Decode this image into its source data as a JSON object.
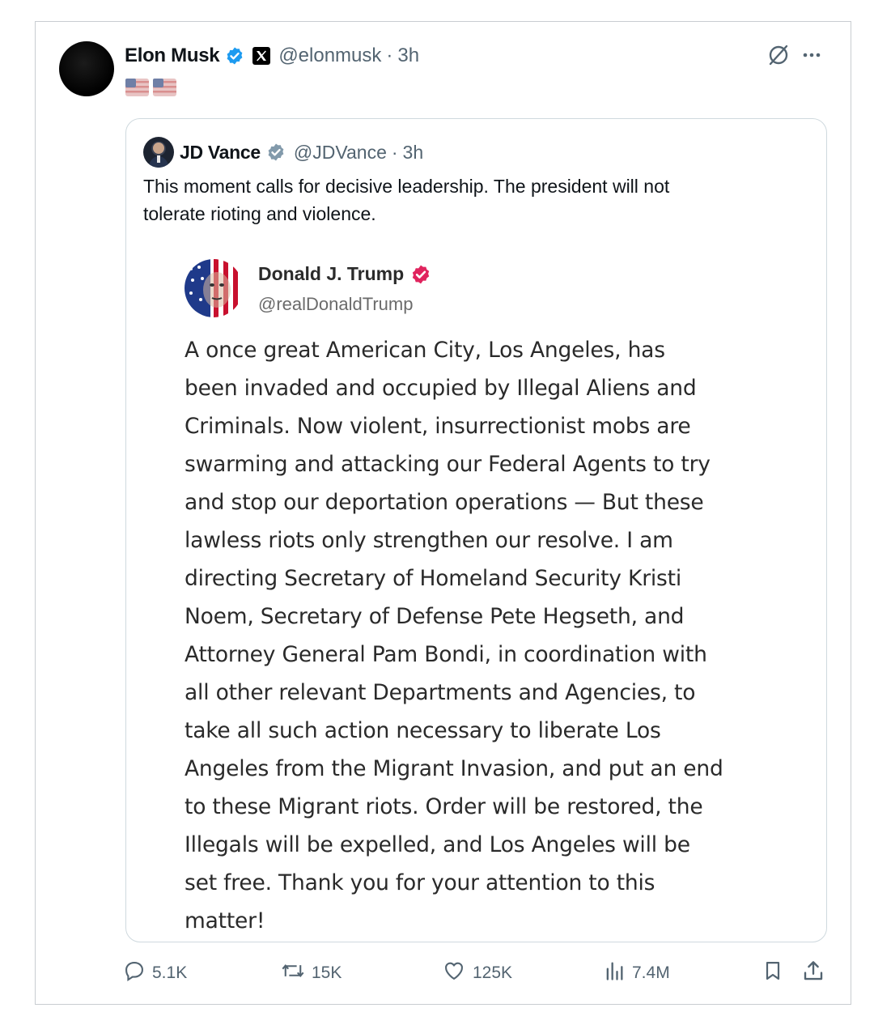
{
  "tweet": {
    "author_name": "Elon Musk",
    "handle": "@elonmusk",
    "time": "3h",
    "separator": "·",
    "flags": [
      "🇺🇸",
      "🇺🇸"
    ]
  },
  "quoted": {
    "author_name": "JD Vance",
    "handle": "@JDVance",
    "time": "3h",
    "separator": "·",
    "text_lines": [
      "This moment calls for decisive leadership. The president will not",
      "tolerate rioting and violence."
    ]
  },
  "screenshot_post": {
    "author_name": "Donald J. Trump",
    "handle": "@realDonaldTrump",
    "text_lines": [
      "A once great American City, Los Angeles, has",
      "been invaded and occupied by Illegal Aliens and",
      "Criminals.  Now violent, insurrectionist mobs are",
      "swarming and attacking our Federal Agents to try",
      "and stop our deportation operations — But these",
      "lawless riots only strengthen our resolve. I am",
      "directing Secretary of Homeland Security Kristi",
      "Noem, Secretary of Defense Pete Hegseth, and",
      "Attorney General Pam Bondi, in coordination with",
      "all other relevant Departments and Agencies, to",
      "take all such action necessary to liberate Los",
      "Angeles from the Migrant Invasion, and put an end",
      "to these Migrant riots. Order will be restored, the",
      "Illegals will be expelled, and Los Angeles will be",
      "set free. Thank you for your attention to this",
      "matter!"
    ]
  },
  "actions": {
    "replies": "5.1K",
    "reposts": "15K",
    "likes": "125K",
    "views": "7.4M"
  },
  "icons": {
    "verified": "verified-badge-icon",
    "x_logo": "x-logo-icon",
    "grok": "grok-icon",
    "more": "more-icon",
    "reply": "reply-icon",
    "repost": "repost-icon",
    "like": "heart-icon",
    "views": "views-icon",
    "bookmark": "bookmark-icon",
    "share": "share-icon"
  },
  "colors": {
    "verified_blue": "#1d9bf0",
    "verified_gray": "#829aab",
    "trump_badge": "#e0245e",
    "secondary_text": "#536471"
  }
}
